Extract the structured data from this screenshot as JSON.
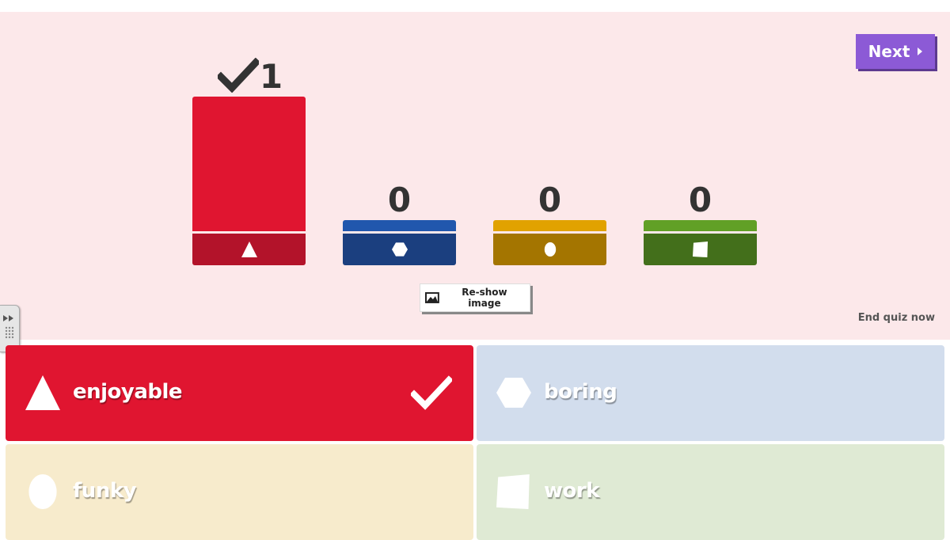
{
  "controls": {
    "next_label": "Next",
    "reshow_label": "Re-show image",
    "end_quiz_label": "End quiz now"
  },
  "colors": {
    "red": "#e01530",
    "blue": "#2157ad",
    "yellow": "#e1a200",
    "green": "#61a026"
  },
  "chart_data": {
    "type": "bar",
    "categories": [
      "enjoyable",
      "boring",
      "funky",
      "work"
    ],
    "values": [
      1,
      0,
      0,
      0
    ],
    "value_labels": [
      "1",
      "0",
      "0",
      "0"
    ],
    "correct_index": 0,
    "shapes": [
      "triangle-icon",
      "hexagon-icon",
      "circle-icon",
      "square-icon"
    ]
  },
  "answers": [
    {
      "text": "enjoyable",
      "shape": "triangle-icon",
      "correct": true,
      "color": "#e01530"
    },
    {
      "text": "boring",
      "shape": "hexagon-icon",
      "correct": false,
      "color": "#d2dded"
    },
    {
      "text": "funky",
      "shape": "circle-icon",
      "correct": false,
      "color": "#f7ebcc"
    },
    {
      "text": "work",
      "shape": "square-icon",
      "correct": false,
      "color": "#dfead4"
    }
  ]
}
